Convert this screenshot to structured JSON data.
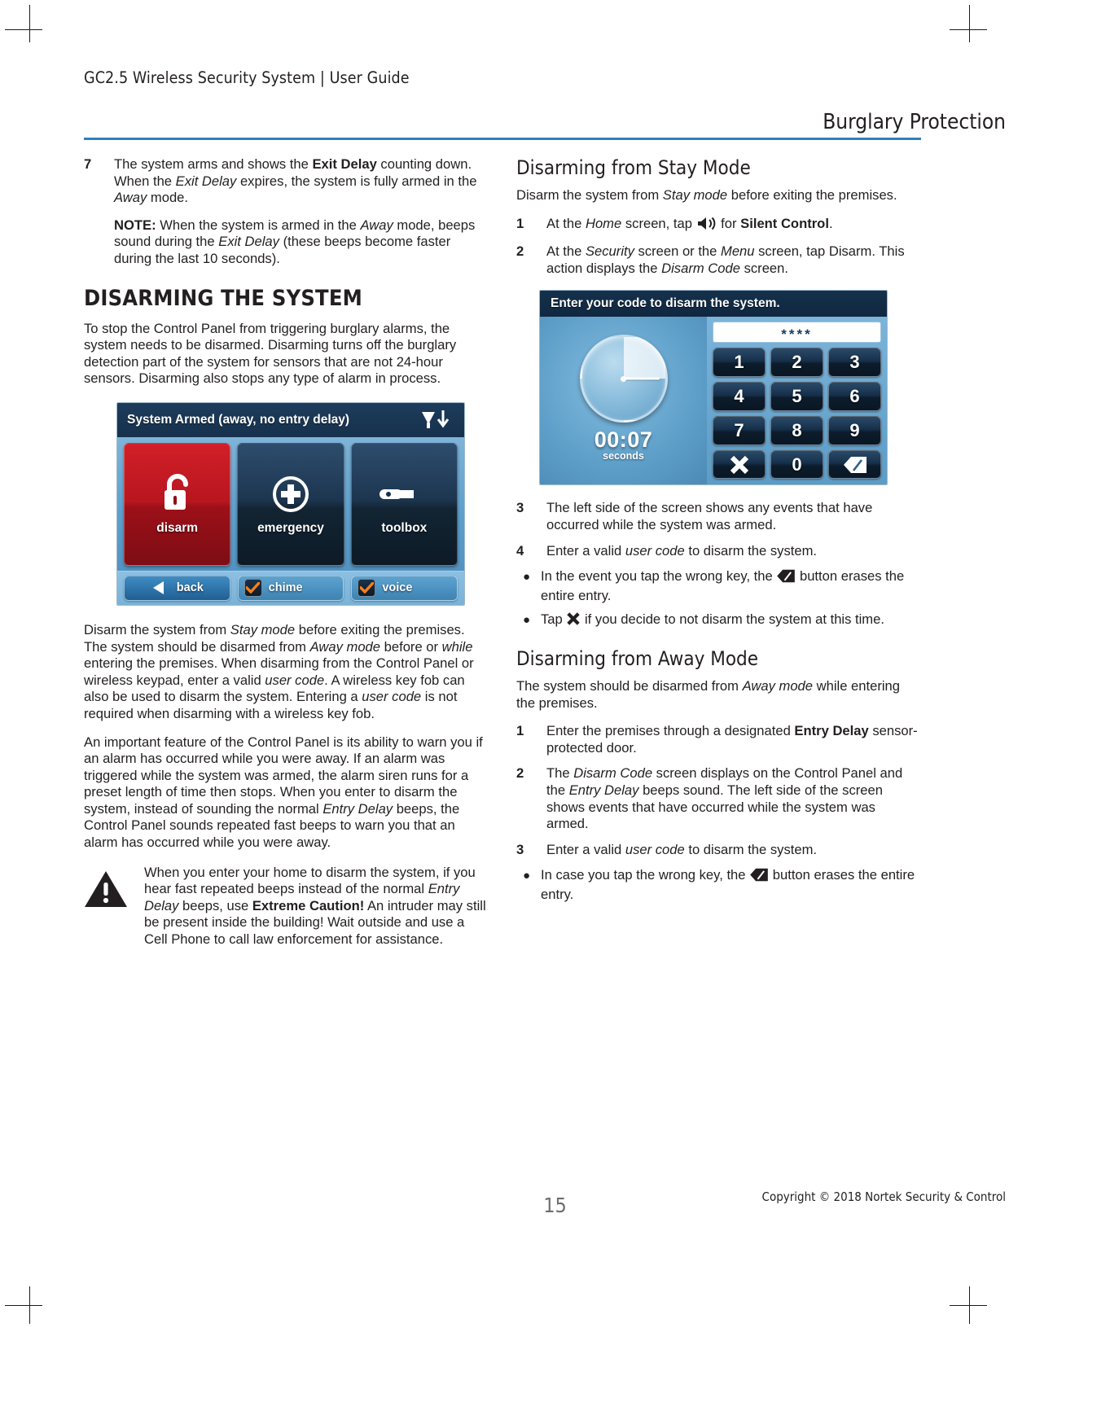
{
  "header": {
    "running_head": "GC2.5 Wireless Security System | User Guide",
    "chapter_title": "Burglary Protection",
    "rule_color": "#2f7fc1"
  },
  "footer": {
    "page_number": "15",
    "copyright": "Copyright ©  2018 Nortek Security & Control"
  },
  "left_column": {
    "step7": {
      "num": "7",
      "para1_a": "The system arms and shows the ",
      "para1_b": "Exit Delay",
      "para1_c": " counting down. When the ",
      "para1_d": "Exit Delay",
      "para1_e": " expires, the system is fully armed in the ",
      "para1_f": "Away",
      "para1_g": " mode.",
      "note_label": "NOTE:",
      "note_a": " When the system is armed in the ",
      "note_b": "Away",
      "note_c": " mode, beeps sound during the ",
      "note_d": "Exit Delay",
      "note_e": " (these beeps become faster during the last 10 seconds)."
    },
    "heading_disarming": "DISARMING THE SYSTEM",
    "intro": "To stop the Control Panel from triggering burglary alarms, the system needs to be disarmed. Disarming turns off the burglary detection part of the system for sensors that are not 24-hour sensors. Disarming also stops any type of alarm in process.",
    "para_stay": {
      "a": "Disarm the system from ",
      "b": "Stay mode",
      "c": " before exiting the premises. The system should be disarmed from ",
      "d": "Away mode",
      "e": " before or ",
      "f": "while",
      "g": " entering the premises. When disarming from the Control Panel or wireless keypad, enter a valid ",
      "h": "user code",
      "i": ". A wireless key fob can also be used to disarm the system. Entering a ",
      "j": "user code",
      "k": " is not required when disarming with a wireless key fob."
    },
    "para_alarm": {
      "a": "An important feature of the Control Panel is its ability to warn you if an alarm has occurred while you were away. If an alarm was triggered while the system was armed, the alarm siren runs for a preset length of time then stops. When you enter to disarm the system, instead of sounding the normal ",
      "b": "Entry Delay",
      "c": " beeps, the Control Panel sounds repeated fast beeps to warn you that an alarm has occurred while you were away."
    },
    "warning": {
      "icon": "warning-triangle-icon",
      "a": "When you enter your home to disarm the system, if you hear fast repeated beeps instead of the normal ",
      "b": "Entry Delay",
      "c": " beeps, use ",
      "d": "Extreme Caution!",
      "e": "  An intruder may still be present inside the building! Wait outside and use a Cell Phone to call law enforcement for assistance."
    }
  },
  "device_armed": {
    "status_title": "System Armed (away, no entry delay)",
    "status_icons": [
      "wifi-icon",
      "battery-icon"
    ],
    "tiles": [
      {
        "label": "disarm",
        "icon": "unlocked-padlock-icon",
        "color": "#c01a24"
      },
      {
        "label": "emergency",
        "icon": "emergency-plus-icon",
        "color": "#17304a"
      },
      {
        "label": "toolbox",
        "icon": "wrench-icon",
        "color": "#17304a"
      }
    ],
    "nav": [
      {
        "label": "back",
        "icon": "left-triangle-icon",
        "checked": false
      },
      {
        "label": "chime",
        "icon": "checkmark-icon",
        "checked": true
      },
      {
        "label": "voice",
        "icon": "checkmark-icon",
        "checked": true
      }
    ],
    "check_color": "#f08020"
  },
  "device_disarm_code": {
    "prompt": "Enter your code to disarm the system.",
    "code_entry": "****",
    "timer_value": "00:07",
    "timer_unit": "seconds",
    "keys": [
      "1",
      "2",
      "3",
      "4",
      "5",
      "6",
      "7",
      "8",
      "9"
    ],
    "key_cancel": "cancel-x-icon",
    "key_zero": "0",
    "key_backspace": "backspace-erase-icon"
  },
  "right_column": {
    "heading_stay": "Disarming from Stay Mode",
    "stay_intro": {
      "a": "Disarm the system from ",
      "b": "Stay mode",
      "c": " before exiting the premises."
    },
    "stay_steps": [
      {
        "num": "1",
        "a": "At the ",
        "b": "Home",
        "c": " screen, tap ",
        "icon": "speaker-icon",
        "d": " for ",
        "e": "Silent Control",
        "f": "."
      },
      {
        "num": "2",
        "a": "At the ",
        "b": "Security",
        "c": " screen or the ",
        "d": "Menu",
        "e": " screen, tap Disarm. This action displays the ",
        "f": "Disarm Code",
        "g": " screen."
      },
      {
        "num": "3",
        "a": "The left side of the screen shows any events that have occurred while the system was armed."
      },
      {
        "num": "4",
        "a": "Enter a valid ",
        "b": "user code",
        "c": " to disarm the system."
      }
    ],
    "stay_bullets": [
      {
        "a": "In the event you tap the wrong key, the ",
        "icon": "backspace-erase-icon",
        "b": " button erases the entire entry."
      },
      {
        "a": "Tap ",
        "icon": "cancel-x-icon",
        "b": " if you decide to not disarm the system at this time."
      }
    ],
    "heading_away": "Disarming from Away Mode",
    "away_intro": {
      "a": "The system should be disarmed from ",
      "b": "Away mode",
      "c": " while entering the premises."
    },
    "away_steps": [
      {
        "num": "1",
        "a": "Enter the premises through a designated ",
        "b": "Entry Delay",
        "c": " sensor-protected door."
      },
      {
        "num": "2",
        "a": "The ",
        "b": "Disarm Code",
        "c": " screen displays on the Control Panel and the ",
        "d": "Entry Delay",
        "e": " beeps sound. The left side of the screen shows events that have occurred while the system was armed."
      },
      {
        "num": "3",
        "a": "Enter a valid ",
        "b": "user code",
        "c": " to disarm the system."
      }
    ],
    "away_bullets": [
      {
        "a": "In case you tap the wrong key, the ",
        "icon": "backspace-erase-icon",
        "b": " button erases the entire entry."
      }
    ]
  }
}
